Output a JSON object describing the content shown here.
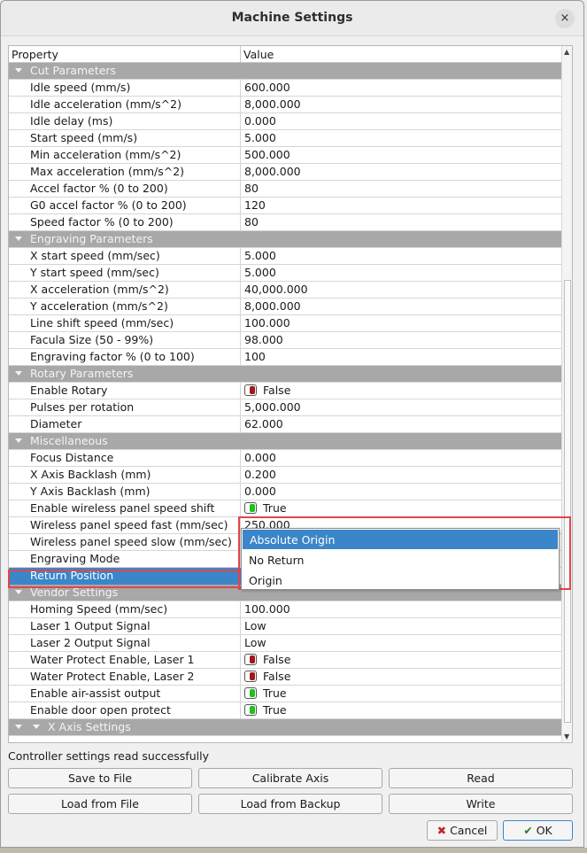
{
  "window": {
    "title": "Machine Settings",
    "close_icon": "×"
  },
  "table": {
    "headers": {
      "property": "Property",
      "value": "Value"
    },
    "rows": [
      {
        "type": "category",
        "label": "Cut Parameters"
      },
      {
        "type": "item",
        "label": "Idle speed (mm/s)",
        "value": "600.000"
      },
      {
        "type": "item",
        "label": "Idle acceleration (mm/s^2)",
        "value": "8,000.000"
      },
      {
        "type": "item",
        "label": "Idle delay (ms)",
        "value": "0.000"
      },
      {
        "type": "item",
        "label": "Start speed (mm/s)",
        "value": "5.000"
      },
      {
        "type": "item",
        "label": "Min acceleration (mm/s^2)",
        "value": "500.000"
      },
      {
        "type": "item",
        "label": "Max acceleration (mm/s^2)",
        "value": "8,000.000"
      },
      {
        "type": "item",
        "label": "Accel factor % (0 to 200)",
        "value": "80"
      },
      {
        "type": "item",
        "label": "G0 accel factor % (0 to 200)",
        "value": "120"
      },
      {
        "type": "item",
        "label": "Speed factor % (0 to 200)",
        "value": "80"
      },
      {
        "type": "category",
        "label": "Engraving Parameters"
      },
      {
        "type": "item",
        "label": "X start speed (mm/sec)",
        "value": "5.000"
      },
      {
        "type": "item",
        "label": "Y start speed (mm/sec)",
        "value": "5.000"
      },
      {
        "type": "item",
        "label": "X acceleration (mm/s^2)",
        "value": "40,000.000"
      },
      {
        "type": "item",
        "label": "Y acceleration (mm/s^2)",
        "value": "8,000.000"
      },
      {
        "type": "item",
        "label": "Line shift speed (mm/sec)",
        "value": "100.000"
      },
      {
        "type": "item",
        "label": "Facula Size (50 - 99%)",
        "value": "98.000"
      },
      {
        "type": "item",
        "label": "Engraving factor % (0 to 100)",
        "value": "100"
      },
      {
        "type": "category",
        "label": "Rotary Parameters"
      },
      {
        "type": "bool",
        "label": "Enable Rotary",
        "value": "False",
        "state": "off"
      },
      {
        "type": "item",
        "label": "Pulses per rotation",
        "value": "5,000.000"
      },
      {
        "type": "item",
        "label": "Diameter",
        "value": "62.000"
      },
      {
        "type": "category",
        "label": "Miscellaneous"
      },
      {
        "type": "item",
        "label": "Focus Distance",
        "value": "0.000"
      },
      {
        "type": "item",
        "label": "X Axis Backlash (mm)",
        "value": "0.200"
      },
      {
        "type": "item",
        "label": "Y Axis Backlash (mm)",
        "value": "0.000"
      },
      {
        "type": "bool",
        "label": "Enable wireless panel speed shift",
        "value": "True",
        "state": "on"
      },
      {
        "type": "item",
        "label": "Wireless panel speed fast (mm/sec)",
        "value": "250.000"
      },
      {
        "type": "item",
        "label": "Wireless panel speed slow (mm/sec)",
        "value": ""
      },
      {
        "type": "item",
        "label": "Engraving Mode",
        "value": ""
      },
      {
        "type": "item",
        "label": "Return Position",
        "value": "",
        "selected": true
      },
      {
        "type": "category",
        "label": "Vendor Settings"
      },
      {
        "type": "item",
        "label": "Homing Speed (mm/sec)",
        "value": "100.000"
      },
      {
        "type": "item",
        "label": "Laser 1 Output Signal",
        "value": "Low"
      },
      {
        "type": "item",
        "label": "Laser 2 Output Signal",
        "value": "Low"
      },
      {
        "type": "bool",
        "label": "Water Protect Enable, Laser 1",
        "value": "False",
        "state": "off"
      },
      {
        "type": "bool",
        "label": "Water Protect Enable, Laser 2",
        "value": "False",
        "state": "off"
      },
      {
        "type": "bool",
        "label": "Enable air-assist output",
        "value": "True",
        "state": "on"
      },
      {
        "type": "bool",
        "label": "Enable door open protect",
        "value": "True",
        "state": "on"
      },
      {
        "type": "category",
        "label": "X Axis Settings",
        "sub": true
      }
    ]
  },
  "dropdown": {
    "options": [
      "Absolute Origin",
      "No Return",
      "Origin"
    ],
    "active_index": 0
  },
  "status": "Controller settings read successfully",
  "buttons": {
    "save_to_file": "Save to File",
    "calibrate_axis": "Calibrate Axis",
    "read": "Read",
    "load_from_file": "Load from File",
    "load_from_backup": "Load from Backup",
    "write": "Write",
    "cancel": "Cancel",
    "ok": "OK"
  },
  "colors": {
    "selection": "#3b86c9",
    "category_bg": "#a8a8a8",
    "toggle_on": "#1fc01f",
    "toggle_off": "#a01818",
    "annotation": "#e0454d"
  }
}
